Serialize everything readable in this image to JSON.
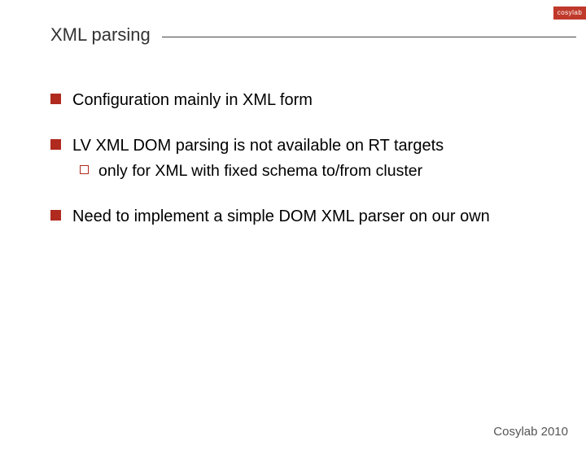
{
  "logo": "cosylab",
  "title": "XML parsing",
  "bullets": {
    "b1": "Configuration mainly in XML form",
    "b2": "LV XML DOM parsing is not available on RT targets",
    "b2_sub1": "only for XML with fixed schema to/from cluster",
    "b3": "Need to implement a simple DOM XML parser on our own"
  },
  "footer": "Cosylab 2010"
}
